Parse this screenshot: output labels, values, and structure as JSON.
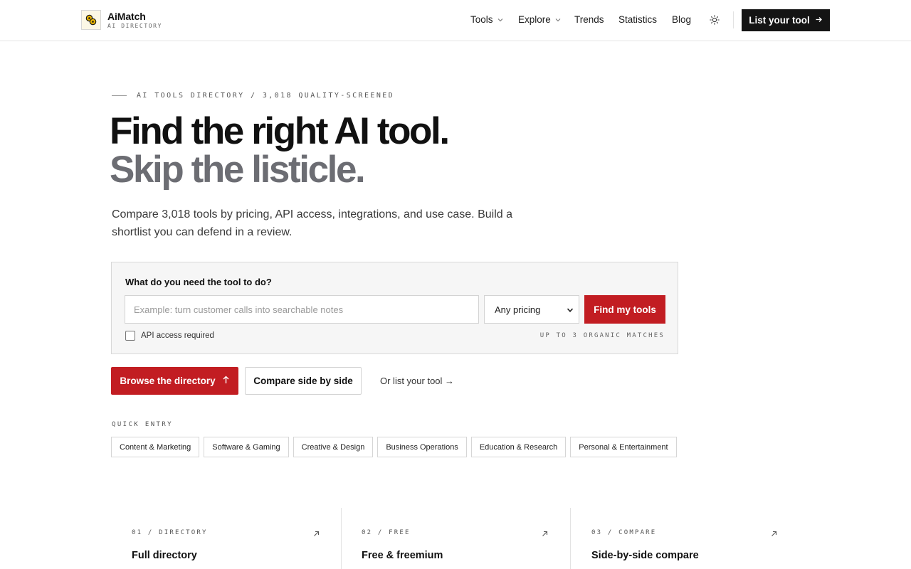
{
  "header": {
    "brand_name": "AiMatch",
    "brand_sub": "AI DIRECTORY",
    "nav": [
      {
        "label": "Tools",
        "has_dropdown": true
      },
      {
        "label": "Explore",
        "has_dropdown": true
      },
      {
        "label": "Trends",
        "has_dropdown": false
      },
      {
        "label": "Statistics",
        "has_dropdown": false
      },
      {
        "label": "Blog",
        "has_dropdown": false
      }
    ],
    "theme_icon": "sun-icon",
    "cta_label": "List your tool"
  },
  "hero": {
    "eyebrow": "AI TOOLS DIRECTORY / 3,018 QUALITY-SCREENED",
    "title_line1": "Find the right AI tool.",
    "title_line2": "Skip the listicle.",
    "lede": "Compare 3,018 tools by pricing, API access, integrations, and use case. Build a shortlist you can defend in a review."
  },
  "search": {
    "label": "What do you need the tool to do?",
    "placeholder": "Example: turn customer calls into searchable notes",
    "value": "",
    "pricing_selected": "Any pricing",
    "submit_label": "Find my tools",
    "checkbox_label": "API access required",
    "checkbox_checked": false,
    "hint": "UP TO 3 ORGANIC MATCHES"
  },
  "actions": {
    "primary_label": "Browse the directory",
    "secondary_label": "Compare side by side",
    "tertiary_label": "Or list your tool →"
  },
  "quick_entry": {
    "label": "QUICK ENTRY",
    "chips": [
      "Content & Marketing",
      "Software & Gaming",
      "Creative & Design",
      "Business Operations",
      "Education & Research",
      "Personal & Entertainment"
    ]
  },
  "features": [
    {
      "num": "01 / DIRECTORY",
      "title": "Full directory"
    },
    {
      "num": "02 / FREE",
      "title": "Free & freemium"
    },
    {
      "num": "03 / COMPARE",
      "title": "Side-by-side compare"
    }
  ],
  "colors": {
    "accent": "#c21d22",
    "dark": "#141414",
    "muted_title": "#6c6d73",
    "logo_bg": "#fbf7e6",
    "logo_mark": "#e8b400"
  }
}
